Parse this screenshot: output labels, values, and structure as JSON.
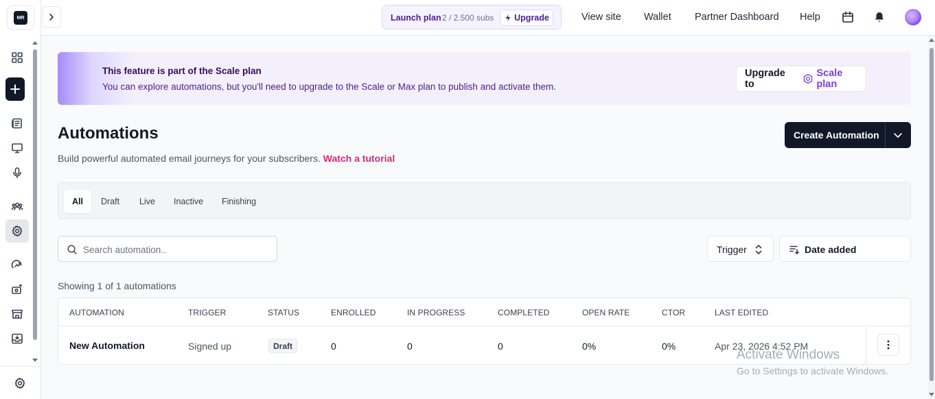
{
  "brand": {
    "logo_text": "MR"
  },
  "sidebar": {
    "icons": [
      "dashboard-icon",
      "plus-icon",
      "posts-icon",
      "website-icon",
      "podcast-icon",
      "audience-icon",
      "settings-icon",
      "growth-icon",
      "monetize-icon",
      "shop-icon",
      "inbox-icon",
      "settings-icon"
    ],
    "active": "automations"
  },
  "topbar": {
    "plan_name": "Launch plan",
    "plan_subs": "2 / 2.500 subs",
    "upgrade_label": "Upgrade",
    "nav": [
      "View site",
      "Wallet",
      "Partner Dashboard",
      "Help"
    ]
  },
  "banner": {
    "title": "This feature is part of the Scale plan",
    "text": "You can explore automations, but you'll need to upgrade to the Scale or Max plan to publish and activate them.",
    "button_prefix": "Upgrade to",
    "button_plan": "Scale plan"
  },
  "page": {
    "title": "Automations",
    "description": "Build powerful automated email journeys for your subscribers.",
    "tutorial_link": "Watch a tutorial",
    "create_button": "Create Automation"
  },
  "tabs": [
    {
      "label": "All",
      "active": true
    },
    {
      "label": "Draft",
      "active": false
    },
    {
      "label": "Live",
      "active": false
    },
    {
      "label": "Inactive",
      "active": false
    },
    {
      "label": "Finishing",
      "active": false
    }
  ],
  "filters": {
    "search_placeholder": "Search automation..",
    "search_value": "",
    "trigger_label": "Trigger",
    "sort_label": "Date added"
  },
  "showing_text": "Showing 1 of 1 automations",
  "table": {
    "columns": [
      "AUTOMATION",
      "TRIGGER",
      "STATUS",
      "ENROLLED",
      "IN PROGRESS",
      "COMPLETED",
      "OPEN RATE",
      "CTOR",
      "LAST EDITED"
    ],
    "rows": [
      {
        "automation": "New Automation",
        "trigger": "Signed up",
        "status": "Draft",
        "enrolled": "0",
        "in_progress": "0",
        "completed": "0",
        "open_rate": "0%",
        "ctor": "0%",
        "last_edited": "Apr 23, 2026 4:52 PM"
      }
    ]
  },
  "watermark": {
    "line1": "Activate Windows",
    "line2": "Go to Settings to activate Windows."
  }
}
